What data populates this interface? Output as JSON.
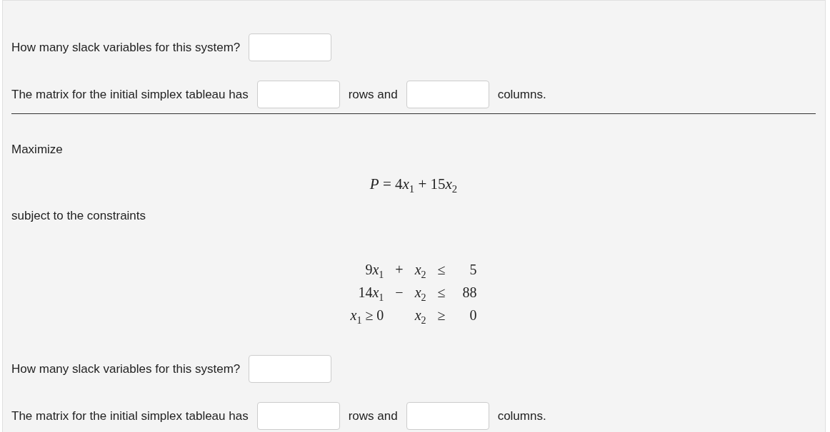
{
  "questions_top": [
    {
      "kind": "single",
      "text": "How many slack variables for this system?"
    },
    {
      "kind": "matrix",
      "before": "The matrix for the initial simplex tableau has",
      "middle": "rows and",
      "after": "columns."
    }
  ],
  "problem": {
    "heading": "Maximize",
    "objective": {
      "variable": "P",
      "relation": "=",
      "terms": [
        {
          "coefficient": "4",
          "variable": "x",
          "index": "1"
        },
        {
          "sign": "+",
          "coefficient": "15",
          "variable": "x",
          "index": "2"
        }
      ]
    },
    "constraints_label": "subject to the constraints",
    "constraints": [
      {
        "term_1": {
          "coefficient": "9",
          "variable": "x",
          "index": "1"
        },
        "operator": "+",
        "term_2": {
          "variable": "x",
          "index": "2"
        },
        "relation": "≤",
        "rhs": "5"
      },
      {
        "term_1": {
          "coefficient": "14",
          "variable": "x",
          "index": "1"
        },
        "operator": "−",
        "term_2": {
          "variable": "x",
          "index": "2"
        },
        "relation": "≤",
        "rhs": "88"
      },
      {
        "term_1": {
          "variable": "x",
          "index": "1",
          "suffix": "≥ 0"
        },
        "term_2": {
          "variable": "x",
          "index": "2"
        },
        "relation": "≥",
        "rhs": "0"
      }
    ]
  },
  "questions_bottom": [
    {
      "kind": "single",
      "text": "How many slack variables for this system?"
    },
    {
      "kind": "matrix",
      "before": "The matrix for the initial simplex tableau has",
      "middle": "rows and",
      "after": "columns."
    }
  ]
}
